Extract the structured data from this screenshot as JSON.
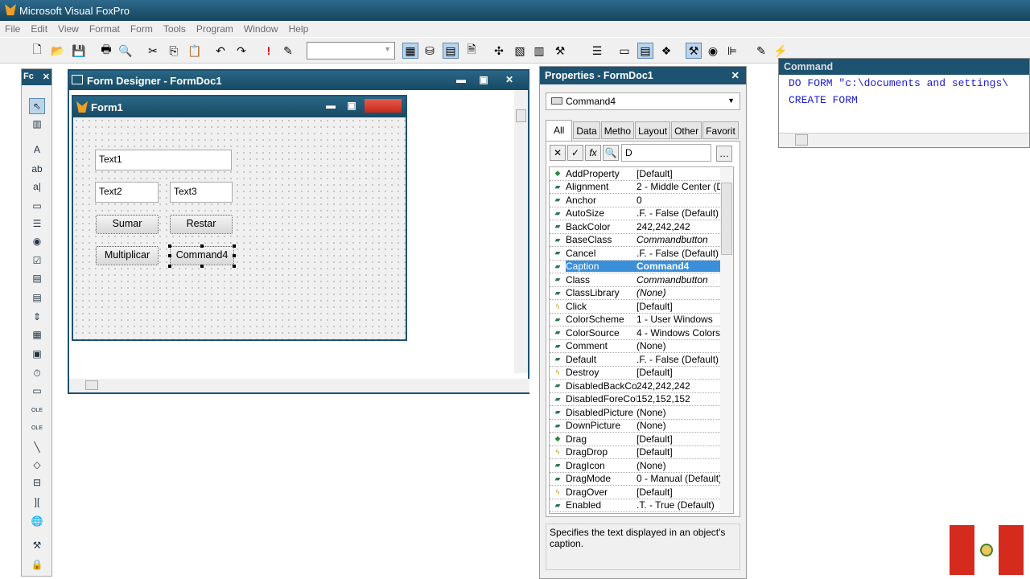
{
  "app": {
    "title": "Microsoft Visual FoxPro"
  },
  "menu": [
    "File",
    "Edit",
    "View",
    "Format",
    "Form",
    "Tools",
    "Program",
    "Window",
    "Help"
  ],
  "toolbox": {
    "title": "Fc",
    "close": "✕"
  },
  "form_designer": {
    "title": "Form Designer - FormDoc1",
    "form_title": "Form1",
    "textboxes": [
      "Text1",
      "Text2",
      "Text3"
    ],
    "buttons": [
      "Sumar",
      "Restar",
      "Multiplicar",
      "Command4"
    ]
  },
  "properties": {
    "title": "Properties - FormDoc1",
    "object": "Command4",
    "tabs": [
      "All",
      "Data",
      "Metho",
      "Layout",
      "Other",
      "Favorit"
    ],
    "edit_value": "D",
    "rows": [
      [
        "AddProperty",
        "[Default]"
      ],
      [
        "Alignment",
        "2 - Middle Center (D"
      ],
      [
        "Anchor",
        "0"
      ],
      [
        "AutoSize",
        ".F. - False (Default)"
      ],
      [
        "BackColor",
        "242,242,242"
      ],
      [
        "BaseClass",
        "Commandbutton"
      ],
      [
        "Cancel",
        ".F. - False (Default)"
      ],
      [
        "Caption",
        "Command4"
      ],
      [
        "Class",
        "Commandbutton"
      ],
      [
        "ClassLibrary",
        "(None)"
      ],
      [
        "Click",
        "[Default]"
      ],
      [
        "ColorScheme",
        "1 - User Windows"
      ],
      [
        "ColorSource",
        "4 - Windows Colors"
      ],
      [
        "Comment",
        "(None)"
      ],
      [
        "Default",
        ".F. - False (Default)"
      ],
      [
        "Destroy",
        "[Default]"
      ],
      [
        "DisabledBackColor",
        "242,242,242"
      ],
      [
        "DisabledForeColor",
        "152,152,152"
      ],
      [
        "DisabledPicture",
        "(None)"
      ],
      [
        "DownPicture",
        "(None)"
      ],
      [
        "Drag",
        "[Default]"
      ],
      [
        "DragDrop",
        "[Default]"
      ],
      [
        "DragIcon",
        "(None)"
      ],
      [
        "DragMode",
        "0 - Manual (Default)"
      ],
      [
        "DragOver",
        "[Default]"
      ],
      [
        "Enabled",
        ".T. - True (Default)"
      ]
    ],
    "description": "Specifies the text displayed in an object's caption."
  },
  "command_window": {
    "title": "Command",
    "lines": [
      "DO FORM \"c:\\documents and settings\\",
      "CREATE FORM"
    ]
  }
}
